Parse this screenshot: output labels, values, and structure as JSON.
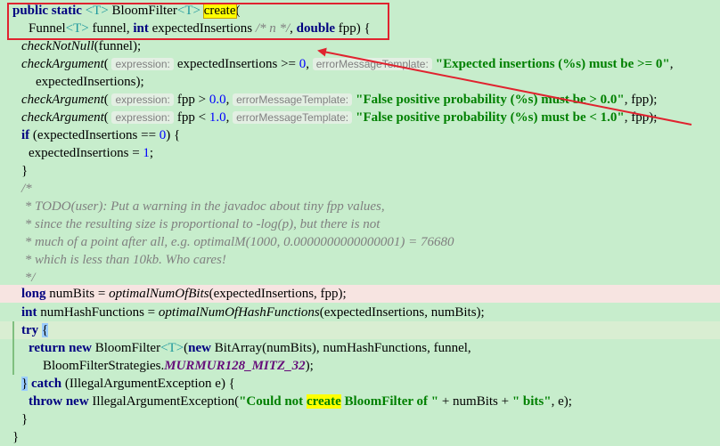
{
  "editor": {
    "line1": {
      "kw_public": "public",
      "kw_static": "static",
      "g1": "<T>",
      "t_bloom": "BloomFilter",
      "g2": "<T>",
      "method": "create",
      "paren": "("
    },
    "line2": {
      "t_funnel": "Funnel",
      "g": "<T>",
      "t_funnel_param": "funnel,",
      "kw_int": "int",
      "t_exp": "expectedInsertions",
      "c_n": "/* n */",
      "t_comma": ",",
      "kw_double": "double",
      "t_fpp": "fpp) {"
    },
    "line3": {
      "fn": "checkNotNull",
      "rest": "(funnel);"
    },
    "line4": {
      "fn": "checkArgument",
      "paren": "(",
      "hint1": "expression:",
      "expr": "expectedInsertions >= ",
      "num": "0",
      "comma": ",",
      "hint2": "errorMessageTemplate:",
      "str": "\"Expected insertions (%s) must be >= 0\"",
      "tail": ","
    },
    "line5": {
      "text": "expectedInsertions);"
    },
    "line6": {
      "fn": "checkArgument",
      "paren": "(",
      "hint1": "expression:",
      "expr": "fpp > ",
      "num": "0.0",
      "comma": ",",
      "hint2": "errorMessageTemplate:",
      "str": "\"False positive probability (%s) must be > 0.0\"",
      "tail": ", fpp);"
    },
    "line7": {
      "fn": "checkArgument",
      "paren": "(",
      "hint1": "expression:",
      "expr": "fpp < ",
      "num": "1.0",
      "comma": ",",
      "hint2": "errorMessageTemplate:",
      "str": "\"False positive probability (%s) must be < 1.0\"",
      "tail": ", fpp);"
    },
    "line8": {
      "kw": "if",
      "rest": "(expectedInsertions == ",
      "num": "0",
      "tail": ") {"
    },
    "line9": {
      "text": "expectedInsertions = ",
      "num": "1",
      "tail": ";"
    },
    "line10": {
      "text": "}"
    },
    "comment": {
      "c1": "/*",
      "c2": " * TODO(user): Put a warning in the javadoc about tiny fpp values,",
      "c3": " * since the resulting size is proportional to -log(p), but there is not",
      "c4": " * much of a point after all, e.g. optimalM(1000, 0.0000000000000001) = 76680",
      "c5": " * which is less than 10kb. Who cares!",
      "c6": " */"
    },
    "line17": {
      "kw": "long",
      "var": "numBits = ",
      "fn": "optimalNumOfBits",
      "rest": "(expectedInsertions, fpp);"
    },
    "line18": {
      "kw": "int",
      "var": "numHashFunctions = ",
      "fn": "optimalNumOfHashFunctions",
      "rest": "(expectedInsertions, numBits);"
    },
    "line19": {
      "kw": "try",
      "brace": "{"
    },
    "line20": {
      "kw_return": "return",
      "kw_new": "new",
      "t1": "BloomFilter",
      "g": "<T>",
      "t2": "(",
      "kw_new2": "new",
      "rest": "BitArray(numBits), numHashFunctions, funnel,"
    },
    "line21": {
      "t": "BloomFilterStrategies.",
      "field": "MURMUR128_MITZ_32",
      "tail": ");"
    },
    "line22": {
      "brace": "}",
      "kw": "catch",
      "rest": "(IllegalArgumentException e) {"
    },
    "line23": {
      "kw_throw": "throw",
      "kw_new": "new",
      "rest": "IllegalArgumentException(",
      "s1": "\"Could not ",
      "s_hl": "create",
      "s2": " BloomFilter of \"",
      "mid": " + numBits + ",
      "s3": "\" bits\"",
      "tail": ", e);"
    },
    "line24": {
      "text": "}"
    },
    "line25": {
      "text": "}"
    }
  },
  "annotation": {
    "color": "#e0232f"
  }
}
